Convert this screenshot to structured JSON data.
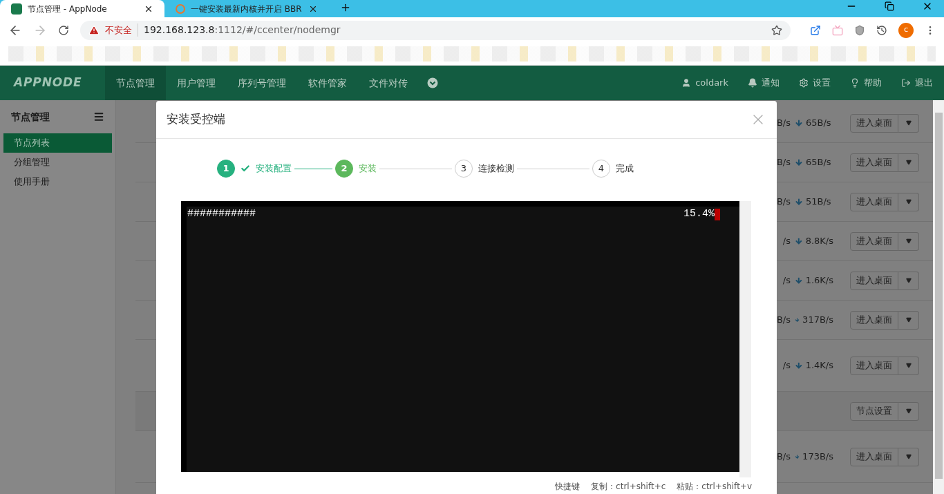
{
  "browser": {
    "tabs": [
      {
        "title": "节点管理 - AppNode",
        "selected": true,
        "kind": "app"
      },
      {
        "title": "一键安装最新内核并开启 BBR",
        "selected": false,
        "kind": "web"
      }
    ],
    "security_label": "不安全",
    "url_host": "192.168.123.8",
    "url_path": ":1112/#/ccenter/nodemgr",
    "avatar": "c"
  },
  "app": {
    "logo": "APPNODE",
    "nav": [
      {
        "label": "节点管理",
        "selected": true
      },
      {
        "label": "用户管理",
        "selected": false
      },
      {
        "label": "序列号管理",
        "selected": false
      },
      {
        "label": "软件管家",
        "selected": false
      },
      {
        "label": "文件对传",
        "selected": false
      }
    ],
    "user_menu": [
      {
        "kind": "user",
        "label": "coldark"
      },
      {
        "kind": "bell",
        "label": "通知"
      },
      {
        "kind": "gear",
        "label": "设置"
      },
      {
        "kind": "bulb",
        "label": "帮助"
      },
      {
        "kind": "logout",
        "label": "退出"
      }
    ]
  },
  "sidebar": {
    "title": "节点管理",
    "items": [
      {
        "label": "节点列表",
        "selected": true
      },
      {
        "label": "分组管理",
        "selected": false
      },
      {
        "label": "使用手册",
        "selected": false
      }
    ]
  },
  "rows": [
    {
      "kind": "node",
      "upload": "B/s",
      "download": "65B/s",
      "button": "进入桌面"
    },
    {
      "kind": "node",
      "upload": "B/s",
      "download": "65B/s",
      "button": "进入桌面"
    },
    {
      "kind": "node",
      "upload": "B/s",
      "download": "51B/s",
      "button": "进入桌面"
    },
    {
      "kind": "node",
      "upload": "/s",
      "download": "8.8K/s",
      "button": "进入桌面"
    },
    {
      "kind": "node",
      "upload": "/s",
      "download": "1.6K/s",
      "button": "进入桌面"
    },
    {
      "kind": "ring_node",
      "upload": "B/s",
      "download": "317B/s",
      "button": "进入桌面"
    },
    {
      "kind": "tall_node",
      "upload": "/s",
      "download": "1.4K/s",
      "button": "进入桌面"
    },
    {
      "kind": "group",
      "button": "节点设置"
    },
    {
      "kind": "tall_node",
      "upload": "B/s",
      "download": "173B/s",
      "button": "进入桌面"
    }
  ],
  "dialog": {
    "title": "安装受控端",
    "steps": [
      {
        "number": "1",
        "label": "安装配置",
        "completed": true,
        "selected": false
      },
      {
        "number": "2",
        "label": "安装",
        "completed": false,
        "selected": true
      },
      {
        "number": "3",
        "label": "连接检测",
        "completed": false,
        "selected": false
      },
      {
        "number": "4",
        "label": "完成",
        "completed": false,
        "selected": false
      }
    ],
    "terminal": {
      "progress_bar": "###########",
      "percent": "15.4%"
    },
    "shortcuts": [
      {
        "label": "快捷键"
      },
      {
        "label": "复制：ctrl+shift+c"
      },
      {
        "label": "粘贴：ctrl+shift+v"
      }
    ]
  }
}
